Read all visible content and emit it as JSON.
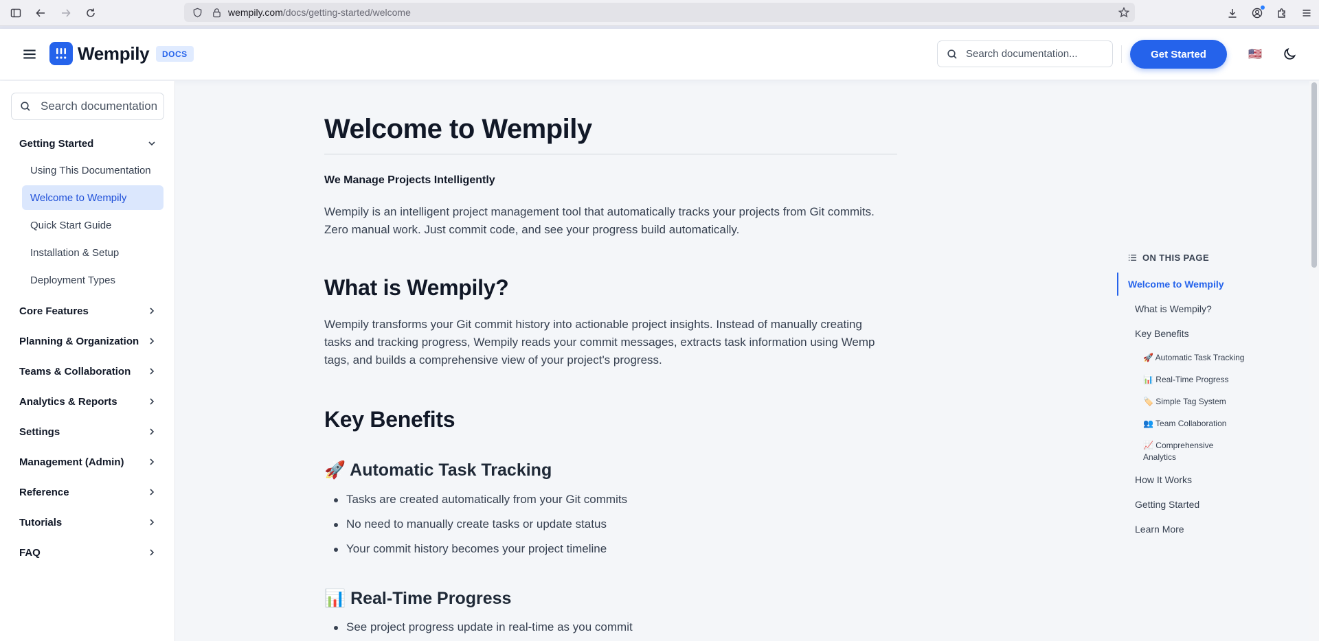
{
  "browser": {
    "url_host": "wempily.com",
    "url_path": "/docs/getting-started/welcome"
  },
  "header": {
    "brand": "Wempily",
    "badge": "DOCS",
    "search_placeholder": "Search documentation...",
    "cta": "Get Started",
    "flag": "🇺🇸"
  },
  "sidebar": {
    "search_placeholder": "Search documentation",
    "getting_started": {
      "label": "Getting Started",
      "items": [
        "Using This Documentation",
        "Welcome to Wempily",
        "Quick Start Guide",
        "Installation & Setup",
        "Deployment Types"
      ],
      "active_index": 1
    },
    "sections": [
      "Core Features",
      "Planning & Organization",
      "Teams & Collaboration",
      "Analytics & Reports",
      "Settings",
      "Management (Admin)",
      "Reference",
      "Tutorials",
      "FAQ"
    ]
  },
  "content": {
    "title": "Welcome to Wempily",
    "lead": "We Manage Projects Intelligently",
    "intro_line1": "Wempily is an intelligent project management tool that automatically tracks your projects from Git commits.",
    "intro_line2": "Zero manual work. Just commit code, and see your progress build automatically.",
    "what_is_heading": "What is Wempily?",
    "what_is_line1": "Wempily transforms your Git commit history into actionable project insights. Instead of manually creating",
    "what_is_line2": "tasks and tracking progress, Wempily reads your commit messages, extracts task information using Wemp",
    "what_is_line3": "tags, and builds a comprehensive view of your project's progress.",
    "key_benefits_heading": "Key Benefits",
    "auto_tracking_heading": "🚀 Automatic Task Tracking",
    "auto_tracking_bullets": [
      "Tasks are created automatically from your Git commits",
      "No need to manually create tasks or update status",
      "Your commit history becomes your project timeline"
    ],
    "realtime_heading": "📊 Real-Time Progress",
    "realtime_bullets": [
      "See project progress update in real-time as you commit"
    ]
  },
  "toc": {
    "heading": "ON THIS PAGE",
    "items": {
      "welcome": "Welcome to Wempily",
      "what_is": "What is Wempily?",
      "key_benefits": "Key Benefits",
      "auto_tracking": "🚀 Automatic Task Tracking",
      "realtime": "📊 Real-Time Progress",
      "tags": "🏷️ Simple Tag System",
      "team": "👥 Team Collaboration",
      "analytics_line1": "📈 Comprehensive",
      "analytics_line2": "Analytics",
      "how_it_works": "How It Works",
      "getting_started": "Getting Started",
      "learn_more": "Learn More"
    }
  },
  "colors": {
    "accent": "#2563eb",
    "active_bg": "#dbe7fd"
  }
}
